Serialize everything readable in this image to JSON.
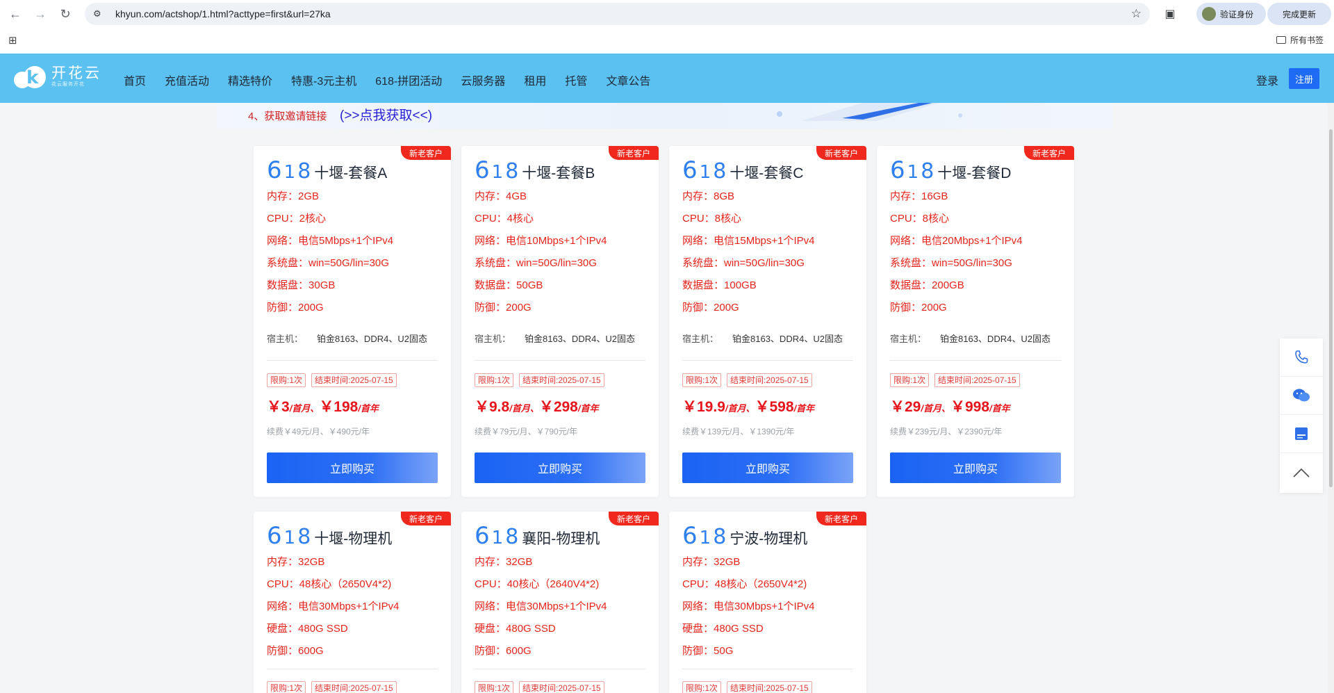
{
  "browser": {
    "url": "khyun.com/actshop/1.html?acttype=first&url=27ka",
    "verify_label": "验证身份",
    "update_label": "完成更新",
    "all_bookmarks": "所有书签"
  },
  "site": {
    "logo_text": "开花云",
    "logo_sub": "花云服务开花",
    "nav": [
      "首页",
      "充值活动",
      "精选特价",
      "特惠-3元主机",
      "618-拼团活动",
      "云服务器",
      "租用",
      "托管",
      "文章公告"
    ],
    "login": "登录",
    "register": "注册"
  },
  "banner": {
    "step": "4、获取邀请链接",
    "link": "(>>点我获取<<)"
  },
  "cards": [
    {
      "badge": "新老客户",
      "num": "618",
      "name": "十堰-套餐A",
      "specs": [
        {
          "label": "内存：",
          "value": "2GB"
        },
        {
          "label": "CPU：",
          "value": "2核心"
        },
        {
          "label": "网络：",
          "value": "电信5Mbps+1个IPv4"
        },
        {
          "label": "系统盘：",
          "value": "win=50G/lin=30G"
        },
        {
          "label": "数据盘：",
          "value": "30GB"
        },
        {
          "label": "防御：",
          "value": "200G"
        }
      ],
      "host_label": "宿主机：",
      "host_value": "铂金8163、DDR4、U2固态",
      "tag_limit": "限购:1次",
      "tag_end": "结束时间:2025-07-15",
      "price_month": "￥3",
      "unit_month": "/首月、",
      "price_year": "￥198",
      "unit_year": "/首年",
      "renew": "续费￥49元/月、￥490元/年",
      "buy": "立即购买"
    },
    {
      "badge": "新老客户",
      "num": "618",
      "name": "十堰-套餐B",
      "specs": [
        {
          "label": "内存：",
          "value": "4GB"
        },
        {
          "label": "CPU：",
          "value": "4核心"
        },
        {
          "label": "网络：",
          "value": "电信10Mbps+1个IPv4"
        },
        {
          "label": "系统盘：",
          "value": "win=50G/lin=30G"
        },
        {
          "label": "数据盘：",
          "value": "50GB"
        },
        {
          "label": "防御：",
          "value": "200G"
        }
      ],
      "host_label": "宿主机：",
      "host_value": "铂金8163、DDR4、U2固态",
      "tag_limit": "限购:1次",
      "tag_end": "结束时间:2025-07-15",
      "price_month": "￥9.8",
      "unit_month": "/首月、",
      "price_year": "￥298",
      "unit_year": "/首年",
      "renew": "续费￥79元/月、￥790元/年",
      "buy": "立即购买"
    },
    {
      "badge": "新老客户",
      "num": "618",
      "name": "十堰-套餐C",
      "specs": [
        {
          "label": "内存：",
          "value": "8GB"
        },
        {
          "label": "CPU：",
          "value": "8核心"
        },
        {
          "label": "网络：",
          "value": "电信15Mbps+1个IPv4"
        },
        {
          "label": "系统盘：",
          "value": "win=50G/lin=30G"
        },
        {
          "label": "数据盘：",
          "value": "100GB"
        },
        {
          "label": "防御：",
          "value": "200G"
        }
      ],
      "host_label": "宿主机：",
      "host_value": "铂金8163、DDR4、U2固态",
      "tag_limit": "限购:1次",
      "tag_end": "结束时间:2025-07-15",
      "price_month": "￥19.9",
      "unit_month": "/首月、",
      "price_year": "￥598",
      "unit_year": "/首年",
      "renew": "续费￥139元/月、￥1390元/年",
      "buy": "立即购买"
    },
    {
      "badge": "新老客户",
      "num": "618",
      "name": "十堰-套餐D",
      "specs": [
        {
          "label": "内存：",
          "value": "16GB"
        },
        {
          "label": "CPU：",
          "value": "8核心"
        },
        {
          "label": "网络：",
          "value": "电信20Mbps+1个IPv4"
        },
        {
          "label": "系统盘：",
          "value": "win=50G/lin=30G"
        },
        {
          "label": "数据盘：",
          "value": "200GB"
        },
        {
          "label": "防御：",
          "value": "200G"
        }
      ],
      "host_label": "宿主机：",
      "host_value": "铂金8163、DDR4、U2固态",
      "tag_limit": "限购:1次",
      "tag_end": "结束时间:2025-07-15",
      "price_month": "￥29",
      "unit_month": "/首月、",
      "price_year": "￥998",
      "unit_year": "/首年",
      "renew": "续费￥239元/月、￥2390元/年",
      "buy": "立即购买"
    },
    {
      "badge": "新老客户",
      "num": "618",
      "name": "十堰-物理机",
      "specs": [
        {
          "label": "内存：",
          "value": "32GB"
        },
        {
          "label": "CPU：",
          "value": "48核心（2650V4*2)"
        },
        {
          "label": "网络：",
          "value": "电信30Mbps+1个IPv4"
        },
        {
          "label": "硬盘：",
          "value": "480G SSD"
        },
        {
          "label": "防御：",
          "value": "600G"
        }
      ],
      "tag_limit": "限购:1次",
      "tag_end": "结束时间:2025-07-15"
    },
    {
      "badge": "新老客户",
      "num": "618",
      "name": "襄阳-物理机",
      "specs": [
        {
          "label": "内存：",
          "value": "32GB"
        },
        {
          "label": "CPU：",
          "value": "40核心（2640V4*2)"
        },
        {
          "label": "网络：",
          "value": "电信30Mbps+1个IPv4"
        },
        {
          "label": "硬盘：",
          "value": "480G SSD"
        },
        {
          "label": "防御：",
          "value": "600G"
        }
      ],
      "tag_limit": "限购:1次",
      "tag_end": "结束时间:2025-07-15"
    },
    {
      "badge": "新老客户",
      "num": "618",
      "name": "宁波-物理机",
      "specs": [
        {
          "label": "内存：",
          "value": "32GB"
        },
        {
          "label": "CPU：",
          "value": "48核心（2650V4*2)"
        },
        {
          "label": "网络：",
          "value": "电信30Mbps+1个IPv4"
        },
        {
          "label": "硬盘：",
          "value": "480G SSD"
        },
        {
          "label": "防御：",
          "value": "50G"
        }
      ],
      "tag_limit": "限购:1次",
      "tag_end": "结束时间:2025-07-15"
    }
  ],
  "float_icons": [
    "phone-icon",
    "chat-icon",
    "document-icon",
    "back-to-top-icon"
  ],
  "colors": {
    "header_bg": "#5bc1f0",
    "accent_blue": "#1e6cf6",
    "price_red": "#e8141b",
    "badge_red": "#f0281d"
  }
}
